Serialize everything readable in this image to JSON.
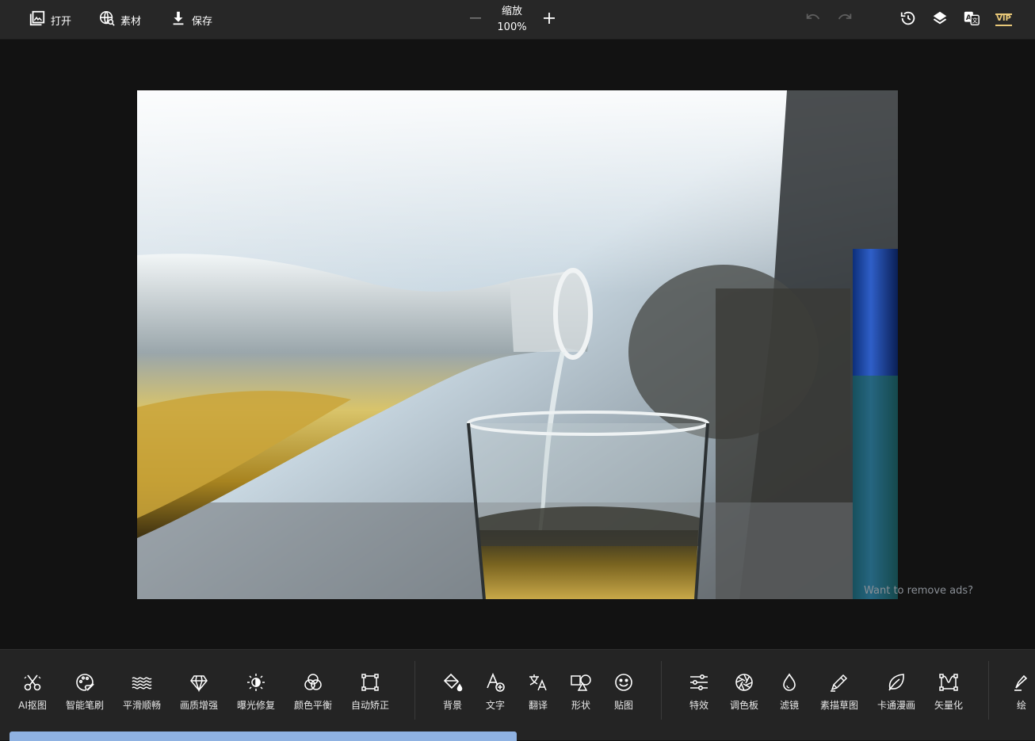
{
  "topbar": {
    "open_label": "打开",
    "open_icon": "image-open-icon",
    "assets_label": "素材",
    "assets_icon": "globe-search-icon",
    "save_label": "保存",
    "save_icon": "download-icon",
    "zoom_title": "缩放",
    "zoom_value": "100%",
    "undo_icon": "undo-icon",
    "redo_icon": "redo-icon",
    "history_icon": "history-icon",
    "layers_icon": "layers-icon",
    "language_icon": "translate-icon",
    "vip_label": "VIP",
    "vip_color": "#e8c878"
  },
  "canvas": {
    "ad_text": "Want to remove ads?"
  },
  "tools": {
    "group1": [
      {
        "label": "AI抠图",
        "icon": "scissors-icon"
      },
      {
        "label": "智能笔刷",
        "icon": "palette-brush-icon"
      },
      {
        "label": "平滑顺畅",
        "icon": "waves-icon"
      },
      {
        "label": "画质增强",
        "icon": "diamond-icon"
      },
      {
        "label": "曝光修复",
        "icon": "brightness-icon"
      },
      {
        "label": "颜色平衡",
        "icon": "color-circles-icon"
      },
      {
        "label": "自动矫正",
        "icon": "crop-frame-icon"
      }
    ],
    "group2": [
      {
        "label": "背景",
        "icon": "paint-bucket-icon"
      },
      {
        "label": "文字",
        "icon": "text-add-icon"
      },
      {
        "label": "翻译",
        "icon": "translate-icon"
      },
      {
        "label": "形状",
        "icon": "shapes-icon"
      },
      {
        "label": "贴图",
        "icon": "smiley-icon"
      }
    ],
    "group3": [
      {
        "label": "特效",
        "icon": "sliders-icon"
      },
      {
        "label": "调色板",
        "icon": "aperture-icon"
      },
      {
        "label": "滤镜",
        "icon": "drop-icon"
      },
      {
        "label": "素描草图",
        "icon": "pencil-icon"
      },
      {
        "label": "卡通漫画",
        "icon": "leaf-icon"
      },
      {
        "label": "矢量化",
        "icon": "vector-nodes-icon"
      }
    ],
    "partial": {
      "label": "绘",
      "icon": "pen-icon"
    }
  },
  "colors": {
    "accent_scrollbar": "#8fb2e2",
    "toolbar_bg": "#242424",
    "topbar_bg": "#272727"
  }
}
